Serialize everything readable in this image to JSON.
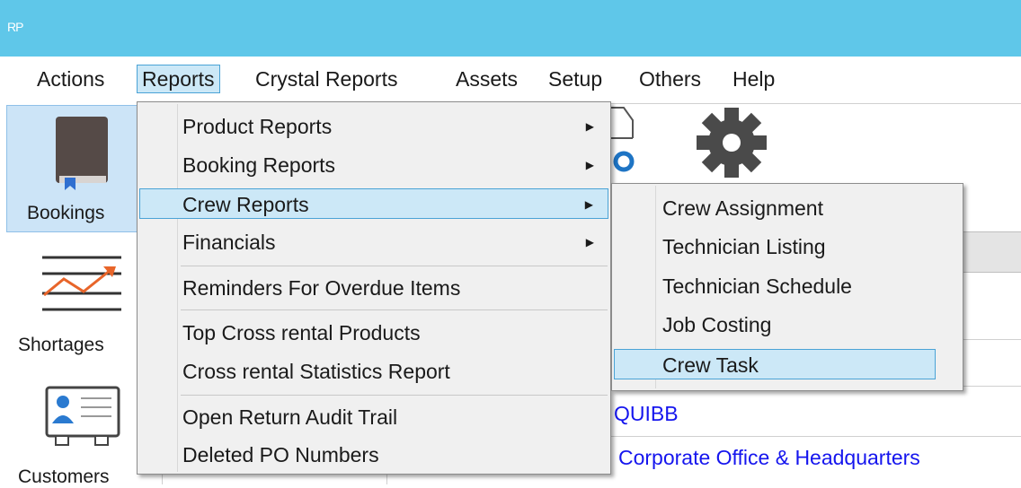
{
  "app": {
    "badge": "RP"
  },
  "menubar": {
    "items": [
      {
        "label": "Actions"
      },
      {
        "label": "Reports"
      },
      {
        "label": "Crystal Reports"
      },
      {
        "label": "Assets"
      },
      {
        "label": "Setup"
      },
      {
        "label": "Others"
      },
      {
        "label": "Help"
      }
    ]
  },
  "sidebar": {
    "items": [
      {
        "label": "Bookings",
        "icon": "book-icon"
      },
      {
        "label": "Shortages",
        "icon": "trend-chart-icon"
      },
      {
        "label": "Customers",
        "icon": "contact-card-icon"
      }
    ]
  },
  "reports_menu": {
    "items": [
      {
        "label": "Product Reports"
      },
      {
        "label": "Booking Reports"
      },
      {
        "label": "Crew Reports"
      },
      {
        "label": "Financials"
      },
      {
        "label": "Reminders For Overdue Items"
      },
      {
        "label": "Top Cross rental Products"
      },
      {
        "label": "Cross rental Statistics Report"
      },
      {
        "label": "Open Return Audit Trail"
      },
      {
        "label": "Deleted PO Numbers"
      }
    ]
  },
  "crew_submenu": {
    "items": [
      {
        "label": "Crew Assignment"
      },
      {
        "label": "Technician Listing"
      },
      {
        "label": "Technician Schedule"
      },
      {
        "label": "Job Costing"
      },
      {
        "label": "Crew Task"
      }
    ]
  },
  "content": {
    "rows": [
      {
        "text": "QUIBB"
      },
      {
        "text": "Corporate Office & Headquarters"
      }
    ]
  },
  "colors": {
    "titlebar": "#5fc7e9",
    "highlight": "#cce8f7",
    "highlight_border": "#4aa3d6",
    "link": "#1515ee"
  }
}
